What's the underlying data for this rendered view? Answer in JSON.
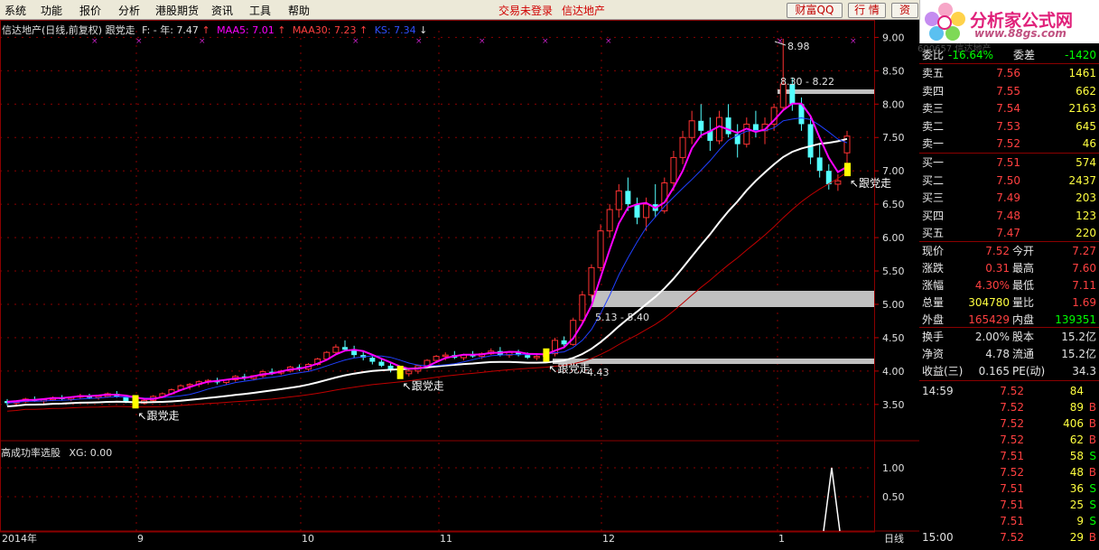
{
  "menu": {
    "items": [
      "系统",
      "功能",
      "报价",
      "分析",
      "港股期货",
      "资讯",
      "工具",
      "帮助"
    ],
    "status_login": "交易未登录",
    "status_stock": "信达地产",
    "btn_caifu": "财富QQ",
    "btn_hangqing": "行 情",
    "btn_zi": "资"
  },
  "logo": {
    "text": "分析家公式网",
    "url": "www.88gs.com"
  },
  "chart_header": {
    "title": "信达地产(日线,前复权)",
    "indicator_name": "跟党走",
    "f_label": "F: - 年: 7.47",
    "maa5": "MAA5: 7.01",
    "maa30": "MAA30: 7.23",
    "ks": "KS: 7.34"
  },
  "annotations": {
    "high": "8.98",
    "zone_top": "8.30 - 8.22",
    "zone_mid": "5.13 - 5.40",
    "zone_low": "4.43",
    "signal": "跟党走"
  },
  "sub_panel": {
    "title": "高成功率选股",
    "xg": "XG: 0.00"
  },
  "price_axis": [
    "9.00",
    "8.50",
    "8.00",
    "7.50",
    "7.00",
    "6.50",
    "6.00",
    "5.50",
    "5.00",
    "4.50",
    "4.00",
    "3.50"
  ],
  "sub_axis": [
    "1.00",
    "0.50"
  ],
  "date_axis": [
    "2014年",
    "9",
    "10",
    "11",
    "12",
    "1"
  ],
  "period_label": "日线",
  "ghost_code": "600657 信达地产",
  "quote": {
    "ratio": {
      "label": "委比",
      "value": "-16.64%",
      "label2": "委差",
      "value2": "-1420"
    },
    "asks": [
      {
        "label": "卖五",
        "price": "7.56",
        "vol": "1461"
      },
      {
        "label": "卖四",
        "price": "7.55",
        "vol": "662"
      },
      {
        "label": "卖三",
        "price": "7.54",
        "vol": "2163"
      },
      {
        "label": "卖二",
        "price": "7.53",
        "vol": "645"
      },
      {
        "label": "卖一",
        "price": "7.52",
        "vol": "46"
      }
    ],
    "bids": [
      {
        "label": "买一",
        "price": "7.51",
        "vol": "574"
      },
      {
        "label": "买二",
        "price": "7.50",
        "vol": "2437"
      },
      {
        "label": "买三",
        "price": "7.49",
        "vol": "203"
      },
      {
        "label": "买四",
        "price": "7.48",
        "vol": "123"
      },
      {
        "label": "买五",
        "price": "7.47",
        "vol": "220"
      }
    ],
    "stats1": [
      {
        "l1": "现价",
        "v1": "7.52",
        "l2": "今开",
        "v2": "7.27"
      },
      {
        "l1": "涨跌",
        "v1": "0.31",
        "l2": "最高",
        "v2": "7.60"
      },
      {
        "l1": "涨幅",
        "v1": "4.30%",
        "l2": "最低",
        "v2": "7.11"
      },
      {
        "l1": "总量",
        "v1": "304780",
        "l2": "量比",
        "v2": "1.69"
      },
      {
        "l1": "外盘",
        "v1": "165429",
        "l2": "内盘",
        "v2": "139351"
      }
    ],
    "stats2": [
      {
        "l1": "换手",
        "v1": "2.00%",
        "l2": "股本",
        "v2": "15.2亿"
      },
      {
        "l1": "净资",
        "v1": "4.78",
        "l2": "流通",
        "v2": "15.2亿"
      },
      {
        "l1": "收益(三)",
        "v1": "0.165",
        "l2": "PE(动)",
        "v2": "34.3"
      }
    ],
    "ticks": [
      {
        "time": "14:59",
        "price": "7.52",
        "vol": "84",
        "side": ""
      },
      {
        "time": "",
        "price": "7.52",
        "vol": "89",
        "side": "B"
      },
      {
        "time": "",
        "price": "7.52",
        "vol": "406",
        "side": "B"
      },
      {
        "time": "",
        "price": "7.52",
        "vol": "62",
        "side": "B"
      },
      {
        "time": "",
        "price": "7.51",
        "vol": "58",
        "side": "S"
      },
      {
        "time": "",
        "price": "7.52",
        "vol": "48",
        "side": "B"
      },
      {
        "time": "",
        "price": "7.51",
        "vol": "36",
        "side": "S"
      },
      {
        "time": "",
        "price": "7.51",
        "vol": "25",
        "side": "S"
      },
      {
        "time": "",
        "price": "7.51",
        "vol": "9",
        "side": "S"
      },
      {
        "time": "15:00",
        "price": "7.52",
        "vol": "29",
        "side": "B"
      }
    ]
  },
  "colors": {
    "bg": "#000000",
    "up": "#ff3232",
    "down": "#54ffff",
    "ma_white": "#ffffff",
    "ma_magenta": "#ff00ff",
    "ma_blue": "#2040ff",
    "ma_red": "#c00000",
    "signal_yellow": "#ffff00",
    "grid_red": "#8b0000",
    "zone_gray": "#c0c0c0"
  },
  "chart_data": {
    "type": "candlestick",
    "ylim": [
      3.2,
      9.1
    ],
    "candles": [
      [
        3.55,
        3.58,
        3.48,
        3.52
      ],
      [
        3.52,
        3.56,
        3.48,
        3.54
      ],
      [
        3.54,
        3.6,
        3.52,
        3.58
      ],
      [
        3.58,
        3.62,
        3.54,
        3.55
      ],
      [
        3.55,
        3.58,
        3.5,
        3.57
      ],
      [
        3.57,
        3.62,
        3.55,
        3.6
      ],
      [
        3.6,
        3.64,
        3.56,
        3.58
      ],
      [
        3.58,
        3.62,
        3.55,
        3.61
      ],
      [
        3.61,
        3.66,
        3.58,
        3.63
      ],
      [
        3.63,
        3.66,
        3.58,
        3.6
      ],
      [
        3.6,
        3.64,
        3.57,
        3.62
      ],
      [
        3.62,
        3.68,
        3.6,
        3.66
      ],
      [
        3.66,
        3.7,
        3.6,
        3.62
      ],
      [
        3.62,
        3.64,
        3.52,
        3.55
      ],
      [
        3.55,
        3.58,
        3.48,
        3.52
      ],
      [
        3.52,
        3.58,
        3.5,
        3.56
      ],
      [
        3.56,
        3.64,
        3.54,
        3.62
      ],
      [
        3.62,
        3.68,
        3.6,
        3.66
      ],
      [
        3.66,
        3.74,
        3.64,
        3.72
      ],
      [
        3.72,
        3.8,
        3.7,
        3.78
      ],
      [
        3.78,
        3.82,
        3.72,
        3.8
      ],
      [
        3.8,
        3.86,
        3.76,
        3.84
      ],
      [
        3.84,
        3.88,
        3.8,
        3.86
      ],
      [
        3.86,
        3.9,
        3.8,
        3.83
      ],
      [
        3.83,
        3.88,
        3.8,
        3.87
      ],
      [
        3.87,
        3.94,
        3.84,
        3.92
      ],
      [
        3.92,
        3.96,
        3.86,
        3.89
      ],
      [
        3.89,
        3.94,
        3.86,
        3.93
      ],
      [
        3.93,
        4.02,
        3.9,
        3.99
      ],
      [
        3.99,
        4.04,
        3.94,
        3.97
      ],
      [
        3.97,
        4.02,
        3.94,
        4.0
      ],
      [
        4.0,
        4.08,
        3.98,
        4.06
      ],
      [
        4.06,
        4.1,
        4.0,
        4.03
      ],
      [
        4.03,
        4.12,
        4.0,
        4.1
      ],
      [
        4.1,
        4.2,
        4.08,
        4.18
      ],
      [
        4.18,
        4.3,
        4.16,
        4.28
      ],
      [
        4.28,
        4.4,
        4.24,
        4.36
      ],
      [
        4.36,
        4.46,
        4.3,
        4.32
      ],
      [
        4.32,
        4.38,
        4.2,
        4.24
      ],
      [
        4.24,
        4.3,
        4.16,
        4.2
      ],
      [
        4.2,
        4.24,
        4.1,
        4.14
      ],
      [
        4.14,
        4.2,
        4.06,
        4.08
      ],
      [
        4.08,
        4.12,
        3.98,
        4.02
      ],
      [
        4.02,
        4.06,
        3.94,
        3.96
      ],
      [
        3.96,
        4.02,
        3.92,
        4.0
      ],
      [
        4.0,
        4.1,
        3.96,
        4.08
      ],
      [
        4.08,
        4.18,
        4.04,
        4.16
      ],
      [
        4.16,
        4.24,
        4.12,
        4.22
      ],
      [
        4.22,
        4.28,
        4.16,
        4.24
      ],
      [
        4.24,
        4.3,
        4.18,
        4.2
      ],
      [
        4.2,
        4.26,
        4.16,
        4.24
      ],
      [
        4.24,
        4.3,
        4.2,
        4.22
      ],
      [
        4.22,
        4.28,
        4.18,
        4.26
      ],
      [
        4.26,
        4.34,
        4.24,
        4.3
      ],
      [
        4.3,
        4.36,
        4.22,
        4.24
      ],
      [
        4.24,
        4.3,
        4.2,
        4.28
      ],
      [
        4.28,
        4.32,
        4.22,
        4.24
      ],
      [
        4.24,
        4.28,
        4.18,
        4.2
      ],
      [
        4.2,
        4.26,
        4.16,
        4.22
      ],
      [
        4.22,
        4.3,
        4.18,
        4.26
      ],
      [
        4.26,
        4.5,
        4.22,
        4.46
      ],
      [
        4.46,
        4.52,
        4.36,
        4.4
      ],
      [
        4.4,
        4.8,
        4.38,
        4.76
      ],
      [
        4.76,
        5.2,
        4.7,
        5.14
      ],
      [
        5.14,
        5.6,
        5.1,
        5.55
      ],
      [
        5.55,
        6.2,
        5.5,
        6.1
      ],
      [
        6.1,
        6.5,
        6.0,
        6.42
      ],
      [
        6.42,
        6.8,
        6.3,
        6.7
      ],
      [
        6.7,
        6.9,
        6.4,
        6.5
      ],
      [
        6.5,
        6.6,
        6.2,
        6.3
      ],
      [
        6.3,
        6.6,
        6.1,
        6.5
      ],
      [
        6.5,
        6.8,
        6.3,
        6.4
      ],
      [
        6.4,
        6.9,
        6.36,
        6.82
      ],
      [
        6.82,
        7.3,
        6.7,
        7.2
      ],
      [
        7.2,
        7.6,
        7.1,
        7.5
      ],
      [
        7.5,
        7.9,
        7.4,
        7.75
      ],
      [
        7.75,
        8.0,
        7.5,
        7.6
      ],
      [
        7.6,
        7.8,
        7.3,
        7.45
      ],
      [
        7.45,
        7.9,
        7.4,
        7.8
      ],
      [
        7.8,
        8.0,
        7.5,
        7.55
      ],
      [
        7.55,
        7.7,
        7.2,
        7.4
      ],
      [
        7.4,
        7.8,
        7.35,
        7.7
      ],
      [
        7.7,
        7.9,
        7.5,
        7.6
      ],
      [
        7.6,
        7.8,
        7.4,
        7.7
      ],
      [
        7.7,
        8.0,
        7.6,
        7.95
      ],
      [
        7.95,
        8.98,
        7.9,
        8.3
      ],
      [
        8.3,
        8.4,
        7.9,
        8.0
      ],
      [
        8.0,
        8.1,
        7.6,
        7.7
      ],
      [
        7.7,
        7.8,
        7.1,
        7.2
      ],
      [
        7.2,
        7.4,
        6.9,
        7.0
      ],
      [
        7.0,
        7.1,
        6.72,
        6.8
      ],
      [
        6.8,
        6.95,
        6.7,
        6.85
      ],
      [
        7.27,
        7.6,
        7.11,
        7.52
      ]
    ]
  }
}
